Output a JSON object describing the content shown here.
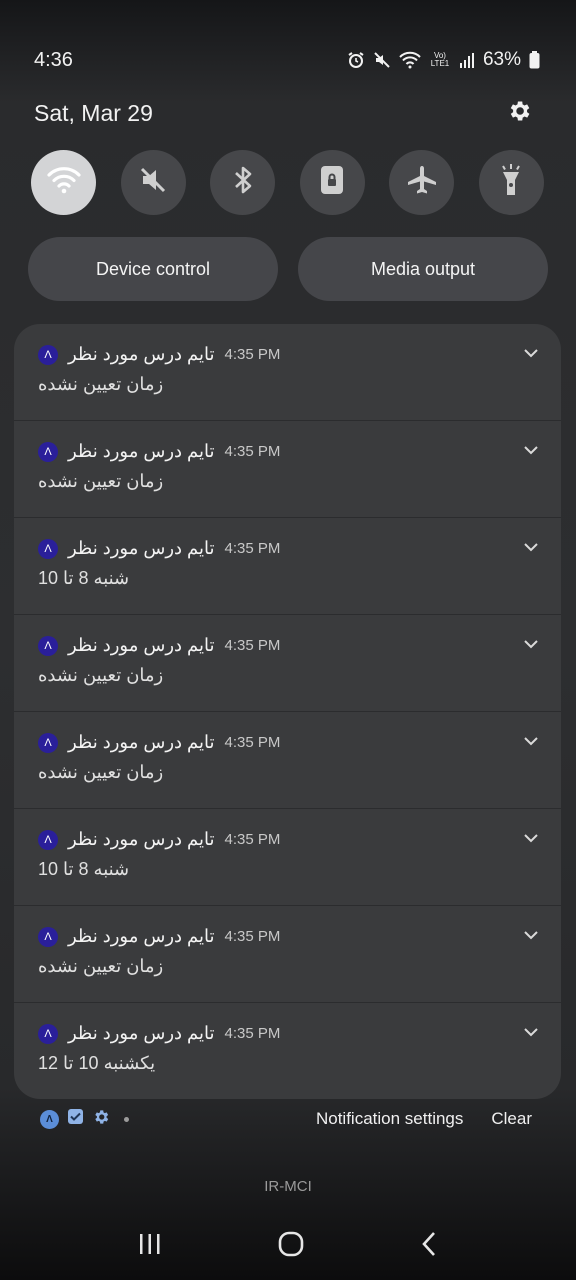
{
  "status_bar": {
    "time": "4:36",
    "battery_percent": "63%",
    "icons": [
      "alarm-icon",
      "mute-icon",
      "wifi-icon",
      "volte-icon",
      "signal-icon",
      "battery-icon"
    ],
    "volte_label": "Vo) LTE1"
  },
  "header": {
    "date": "Sat, Mar 29"
  },
  "quick_tiles": [
    {
      "name": "wifi",
      "active": true
    },
    {
      "name": "mute",
      "active": false
    },
    {
      "name": "bluetooth",
      "active": false
    },
    {
      "name": "rotation-lock",
      "active": false
    },
    {
      "name": "airplane-mode",
      "active": false
    },
    {
      "name": "flashlight",
      "active": false
    }
  ],
  "pills": {
    "device_control": "Device control",
    "media_output": "Media output"
  },
  "notifications": [
    {
      "title": "تایم درس مورد نظر",
      "time": "4:35 PM",
      "body": "زمان تعیین نشده"
    },
    {
      "title": "تایم درس مورد نظر",
      "time": "4:35 PM",
      "body": "زمان تعیین نشده"
    },
    {
      "title": "تایم درس مورد نظر",
      "time": "4:35 PM",
      "body": "شنبه 8 تا 10"
    },
    {
      "title": "تایم درس مورد نظر",
      "time": "4:35 PM",
      "body": "زمان تعیین نشده"
    },
    {
      "title": "تایم درس مورد نظر",
      "time": "4:35 PM",
      "body": "زمان تعیین نشده"
    },
    {
      "title": "تایم درس مورد نظر",
      "time": "4:35 PM",
      "body": "شنبه 8 تا 10"
    },
    {
      "title": "تایم درس مورد نظر",
      "time": "4:35 PM",
      "body": "زمان تعیین نشده"
    },
    {
      "title": "تایم درس مورد نظر",
      "time": "4:35 PM",
      "body": "یکشنبه 10 تا 12"
    }
  ],
  "footer": {
    "settings_label": "Notification settings",
    "clear_label": "Clear"
  },
  "carrier": "IR-MCI",
  "colors": {
    "app_icon": "#2a1f9a",
    "tile_active": "#d3d4d6",
    "tile_inactive": "#46474a",
    "panel": "#3a3b3d"
  }
}
